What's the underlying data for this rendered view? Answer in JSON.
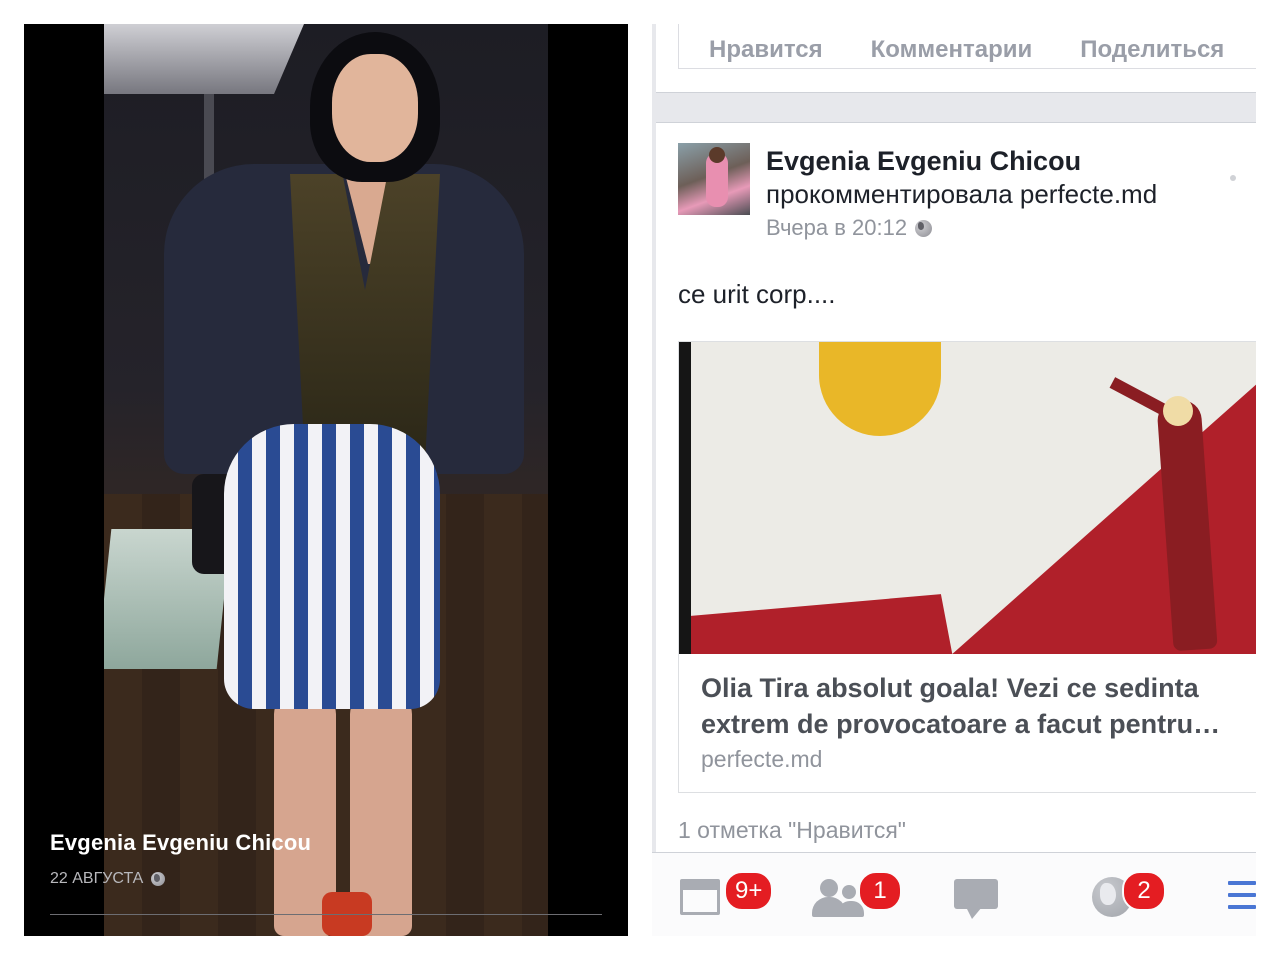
{
  "photo_viewer": {
    "owner_name": "Evgenia Evgeniu Chicou",
    "date": "22 АВГУСТА",
    "privacy_icon": "globe-icon"
  },
  "previous_post": {
    "actions": [
      "Нравится",
      "Комментарии",
      "Поделиться"
    ]
  },
  "post": {
    "author": "Evgenia Evgeniu Chicou",
    "action": "прокомментировала perfecte.md",
    "time": "Вчера в 20:12",
    "privacy_icon": "globe-icon",
    "text": "ce urit corp....",
    "link": {
      "title": "Olia Tira absolut goala! Vezi ce sedinta extrem de provocatoare a facut pentru revista",
      "domain": "perfecte.md"
    },
    "likes": "1 отметка \"Нравится\""
  },
  "bottom_nav": {
    "news_feed": {
      "icon": "news-feed-icon",
      "badge": "9+"
    },
    "friend_requests": {
      "icon": "friends-icon",
      "badge": "1"
    },
    "messages": {
      "icon": "messages-icon",
      "badge": ""
    },
    "notifications": {
      "icon": "globe-icon",
      "badge": "2"
    },
    "more": {
      "icon": "menu-icon"
    }
  },
  "colors": {
    "facebook_blue": "#4a76d4",
    "badge_red": "#e41d22",
    "text_dark": "#1d2129",
    "text_muted": "#90949c"
  }
}
